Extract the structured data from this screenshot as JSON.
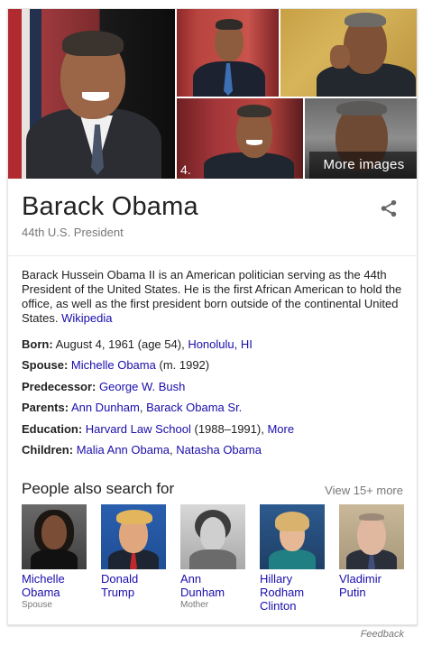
{
  "collage": {
    "more_images_label": "More images",
    "tile_number": "4."
  },
  "entity": {
    "title": "Barack Obama",
    "subtitle": "44th U.S. President",
    "share_icon": "share-icon"
  },
  "description": {
    "text": "Barack Hussein Obama II is an American politician serving as the 44th President of the United States. He is the first African American to hold the office, as well as the first president born outside of the continental United States.",
    "source_link": "Wikipedia"
  },
  "facts": {
    "born": {
      "label": "Born:",
      "text": "August 4, 1961 (age 54),",
      "link": "Honolulu, HI"
    },
    "spouse": {
      "label": "Spouse:",
      "link": "Michelle Obama",
      "text": "(m. 1992)"
    },
    "predecessor": {
      "label": "Predecessor:",
      "link": "George W. Bush"
    },
    "parents": {
      "label": "Parents:",
      "link1": "Ann Dunham",
      "sep": ",",
      "link2": "Barack Obama Sr."
    },
    "education": {
      "label": "Education:",
      "link": "Harvard Law School",
      "text": "(1988–1991),",
      "more_link": "More"
    },
    "children": {
      "label": "Children:",
      "link1": "Malia Ann Obama",
      "sep": ",",
      "link2": "Natasha Obama"
    }
  },
  "people_also_search": {
    "title": "People also search for",
    "view_more": "View 15+ more",
    "people": [
      {
        "name": "Michelle Obama",
        "role": "Spouse"
      },
      {
        "name": "Donald Trump",
        "role": ""
      },
      {
        "name": "Ann Dunham",
        "role": "Mother"
      },
      {
        "name": "Hillary Rodham Clinton",
        "role": ""
      },
      {
        "name": "Vladimir Putin",
        "role": ""
      }
    ]
  },
  "feedback": "Feedback",
  "colors": {
    "link": "#1a0dab",
    "secondary_text": "#777777",
    "primary_text": "#222222",
    "card_border": "#e4e4e4"
  }
}
